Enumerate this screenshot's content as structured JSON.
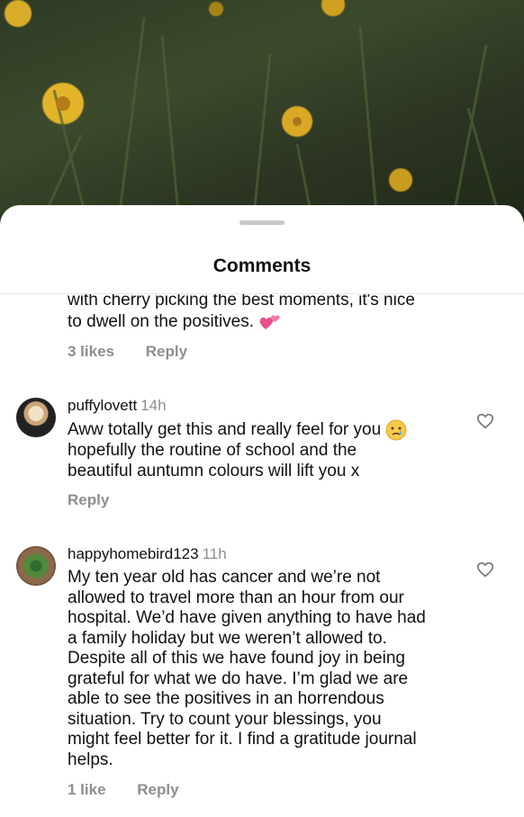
{
  "sheet": {
    "title": "Comments"
  },
  "comments": [
    {
      "partial": true,
      "text_lines": [
        "with cherry picking the best moments, it's nice",
        "to dwell on the positives."
      ],
      "emoji": "heart-emoji",
      "likes": "3 likes",
      "reply": "Reply"
    },
    {
      "username": "puffylovett",
      "time": "14h",
      "text_lines": [
        "Aww totally get this and really feel for you",
        "hopefully the routine of school and the",
        "beautiful auntumn colours will lift you x"
      ],
      "emoji": "crying-face-emoji",
      "reply": "Reply",
      "like_icon": "heart-outline-icon"
    },
    {
      "username": "happyhomebird123",
      "time": "11h",
      "text_lines": [
        "My ten year old has cancer and we’re not",
        "allowed to travel more than an hour from our",
        "hospital. We’d have given anything to have had",
        "a family holiday but we weren’t allowed to.",
        "Despite all of this we have found joy in being",
        "grateful for what we do have. I’m glad we are",
        "able to see the positives in an horrendous",
        "situation. Try to count your blessings, you",
        "might feel better for it. I find a gratitude journal",
        "helps."
      ],
      "likes": "1 like",
      "reply": "Reply",
      "like_icon": "heart-outline-icon"
    }
  ],
  "colors": {
    "secondary_text": "#8e8e8e",
    "primary_text": "#111111",
    "sheet_bg": "#ffffff"
  }
}
